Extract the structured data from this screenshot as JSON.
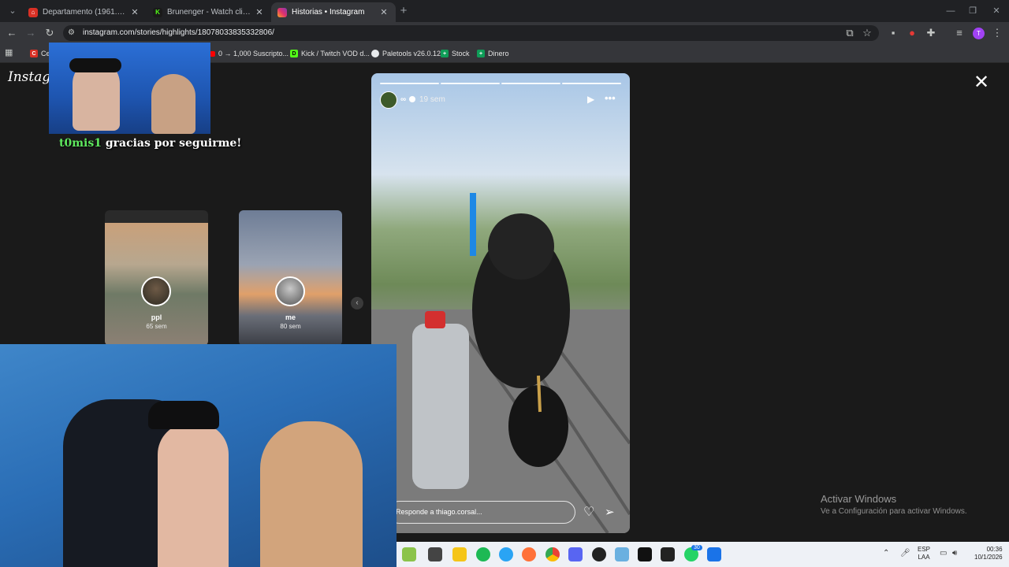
{
  "tabs": [
    {
      "label": "Departamento (1961.28 m²) en",
      "close": "✕"
    },
    {
      "label": "Brunenger - Watch clips on Kick",
      "close": "✕"
    },
    {
      "label": "Historias • Instagram",
      "close": "✕"
    }
  ],
  "new_tab": "+",
  "address": {
    "url": "instagram.com/stories/highlights/18078033835332806/"
  },
  "bookmarks": [
    {
      "label": "0 → 1,000 Suscripto..."
    },
    {
      "label": "Kick / Twitch VOD d..."
    },
    {
      "label": "Paletools v26.0.12"
    },
    {
      "label": "Stock"
    },
    {
      "label": "Dinero"
    }
  ],
  "bookmark_partial": "Ce",
  "instagram": {
    "logo": "Instagram"
  },
  "highlights": [
    {
      "name": "ppl",
      "time": "65 sem"
    },
    {
      "name": "me",
      "time": "80 sem"
    }
  ],
  "story": {
    "user": "∞",
    "time": "19 sem",
    "reply_placeholder": "Responde a thiago.corsal..."
  },
  "overlay": {
    "follower": "t0mis1",
    "message": "gracias por seguirme!"
  },
  "watermark": {
    "line1": "Activar Windows",
    "line2": "Ve a Configuración para activar Windows."
  },
  "taskbar": {
    "lang": "ESP",
    "lang2": "LAA",
    "time": "00:36",
    "date": "10/1/2026",
    "badge": "30"
  }
}
